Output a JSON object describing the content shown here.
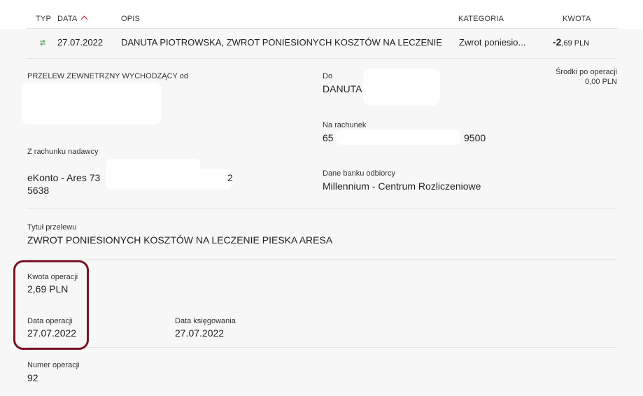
{
  "columns": {
    "typ": "TYP",
    "data": "DATA",
    "opis": "OPIS",
    "kategoria": "KATEGORIA",
    "kwota": "KWOTA"
  },
  "transaction": {
    "type_icon": "swap-arrows-icon",
    "date": "27.07.2022",
    "description": "DANUTA PIOTROWSKA, ZWROT PONIESIONYCH KOSZTÓW NA LECZENIE",
    "category": "Zwrot poniesio...",
    "amount_major": "-2",
    "amount_minor": ",69 PLN"
  },
  "details": {
    "transfer_type": "PRZELEW ZEWNETRZNY WYCHODZĄCY od",
    "to_label": "Do",
    "to_value": "DANUTA",
    "funds_label": "Środki po operacji",
    "funds_value": "0,00 PLN",
    "account_label": "Na rachunek",
    "account_prefix": "65",
    "account_suffix": "9500",
    "from_account_label": "Z rachunku nadawcy",
    "from_account_line1": "eKonto - Ares 73",
    "from_account_tail": "2",
    "from_account_line2": "5638",
    "bank_label": "Dane banku odbiorcy",
    "bank_value": "Millennium - Centrum Rozliczeniowe",
    "title_label": "Tytuł przelewu",
    "title_value": "ZWROT PONIESIONYCH KOSZTÓW NA LECZENIE PIESKA ARESA",
    "amount_label": "Kwota operacji",
    "amount_value": "2,69 PLN",
    "op_date_label": "Data operacji",
    "op_date_value": "27.07.2022",
    "booking_date_label": "Data księgowania",
    "booking_date_value": "27.07.2022",
    "op_number_label": "Numer operacji",
    "op_number_value": "92"
  },
  "colors": {
    "accent": "#c0152a",
    "highlight": "#7a1426",
    "transfer_icon": "#5aa85a"
  }
}
